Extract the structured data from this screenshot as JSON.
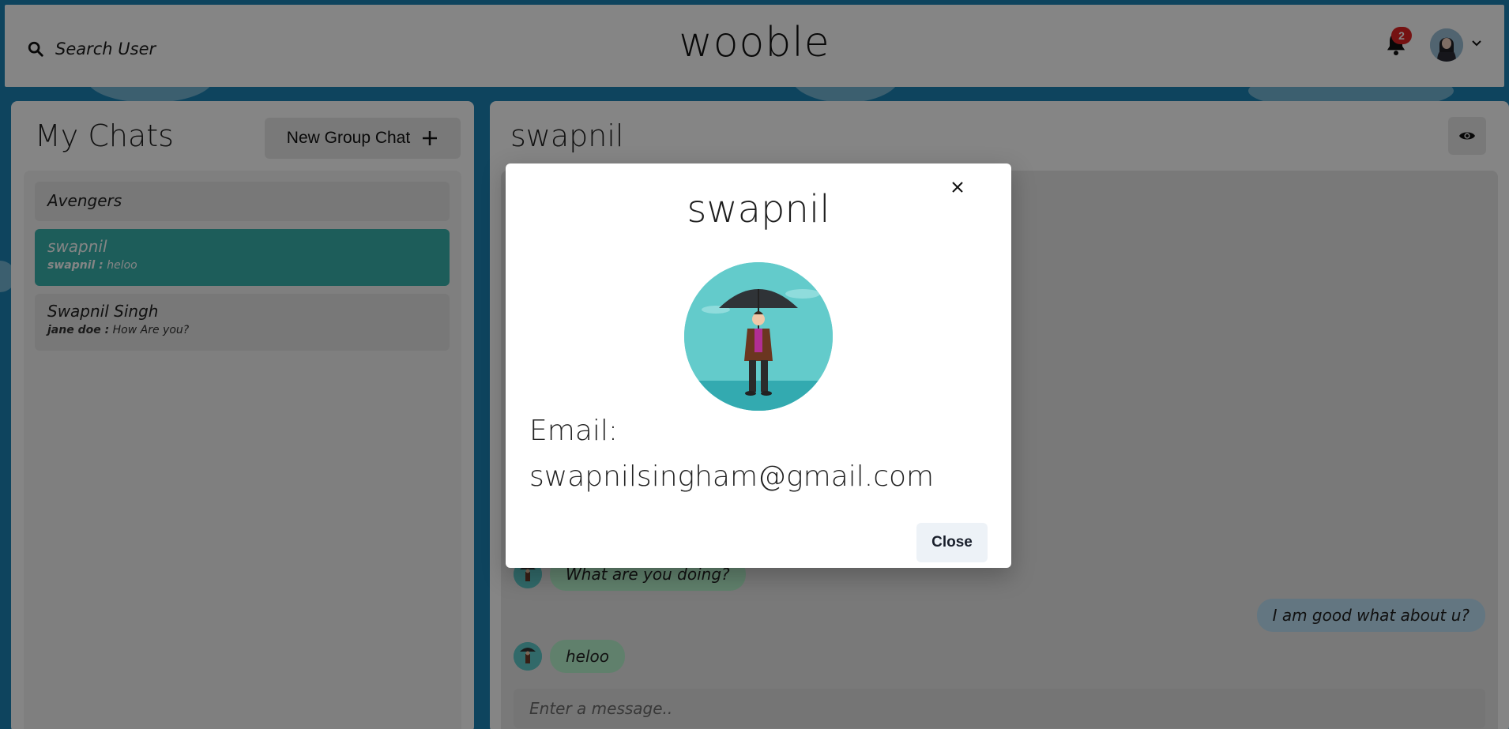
{
  "colors": {
    "accent": "#38b2ac",
    "background": "#1b82b4",
    "badge": "#e02424",
    "bubble_received": "#b9f5d0",
    "bubble_sent": "#bee3f8"
  },
  "header": {
    "search_label": "Search User",
    "logo": "wooble",
    "notification_count": "2"
  },
  "sidebar": {
    "title": "My Chats",
    "new_group_label": "New Group Chat",
    "chats": [
      {
        "name": "Avengers",
        "sender": "",
        "message": ""
      },
      {
        "name": "swapnil",
        "sender": "swapnil :",
        "message": "heloo"
      },
      {
        "name": "Swapnil Singh",
        "sender": "jane doe :",
        "message": "How Are you?"
      }
    ]
  },
  "chat": {
    "title": "swapnil",
    "messages": [
      {
        "text": "What are you doing?",
        "from": "other"
      },
      {
        "text": "I am good what about u?",
        "from": "me"
      },
      {
        "text": "heloo",
        "from": "other"
      }
    ],
    "input_placeholder": "Enter a message.."
  },
  "modal": {
    "title": "swapnil",
    "email_label": "Email:",
    "email_value": "swapnilsingham@gmail.com",
    "close_label": "Close"
  }
}
